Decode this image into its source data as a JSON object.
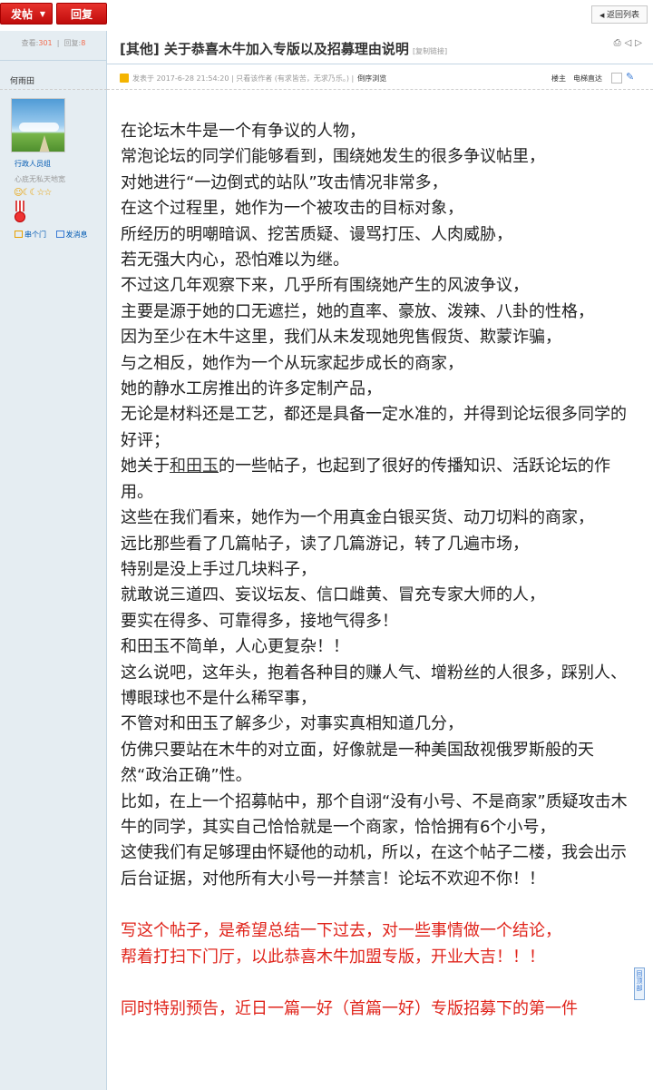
{
  "toolbar": {
    "post_label": "发帖",
    "post_arrow": "▼",
    "reply_label": "回复",
    "back_label": "返回列表",
    "back_arrow": "◀"
  },
  "stats": {
    "views_label": "查看:",
    "views": "301",
    "replies_label": "回复:",
    "replies": "8"
  },
  "author": {
    "name": "何雨田",
    "group": "行政人员组",
    "signature": "心底无私天地宽",
    "stars": "☺☾☾☆☆",
    "link_visit": "串个门",
    "link_message": "发消息"
  },
  "thread": {
    "title": "[其他] 关于恭喜木牛加入专版以及招募理由说明",
    "copy_link": "[复制链接]",
    "icons": "⎙◁▷"
  },
  "post_meta": {
    "posted_text": "发表于 2017-6-28 21:54:20 | 只看该作者  (有求皆苦，无求乃乐。) |",
    "reverse_label": "倒序浏览",
    "floor_label": "楼主",
    "jump_label": "电梯直达",
    "wrench": "✎"
  },
  "content": {
    "paragraphs": [
      "在论坛木牛是一个有争议的人物，",
      "常泡论坛的同学们能够看到，围绕她发生的很多争议帖里，",
      "对她进行“一边倒式的站队”攻击情况非常多，",
      "在这个过程里，她作为一个被攻击的目标对象，",
      "所经历的明嘲暗讽、挖苦质疑、谩骂打压、人肉威胁，",
      "若无强大内心，恐怕难以为继。",
      "不过这几年观察下来，几乎所有围绕她产生的风波争议，",
      "主要是源于她的口无遮拦，她的直率、豪放、泼辣、八卦的性格，",
      "因为至少在木牛这里，我们从未发现她兜售假货、欺蒙诈骗，",
      "与之相反，她作为一个从玩家起步成长的商家，",
      "她的静水工房推出的许多定制产品，",
      "无论是材料还是工艺，都还是具备一定水准的，并得到论坛很多同学的好评；"
    ],
    "p13_before": "她关于",
    "p13_link": "和田玉",
    "p13_after": "的一些帖子，也起到了很好的传播知识、活跃论坛的作用。",
    "paragraphs2": [
      "这些在我们看来，她作为一个用真金白银买货、动刀切料的商家，",
      "远比那些看了几篇帖子，读了几篇游记，转了几遍市场，",
      "特别是没上手过几块料子，",
      "就敢说三道四、妄议坛友、信口雌黄、冒充专家大师的人，",
      "要实在得多、可靠得多，接地气得多！",
      "和田玉不简单，人心更复杂！！",
      "这么说吧，这年头，抱着各种目的赚人气、增粉丝的人很多，踩别人、博眼球也不是什么稀罕事，",
      "不管对和田玉了解多少，对事实真相知道几分，",
      "仿佛只要站在木牛的对立面，好像就是一种美国敌视俄罗斯般的天然“政治正确”性。",
      "比如，在上一个招募帖中，那个自诩“没有小号、不是商家”质疑攻击木牛的同学，其实自己恰恰就是一个商家，恰恰拥有6个小号，",
      "这使我们有足够理由怀疑他的动机，所以，在这个帖子二楼，我会出示后台证据，对他所有大小号一并禁言！论坛不欢迎不你！！"
    ],
    "red1": "写这个帖子，是希望总结一下过去，对一些事情做一个结论，",
    "red2": "帮着打扫下门厅，以此恭喜木牛加盟专版，开业大吉！！！",
    "red3": "同时特别预告，近日一篇一好（首篇一好）专版招募下的第一件"
  },
  "backtop": {
    "label": "回顶部"
  }
}
